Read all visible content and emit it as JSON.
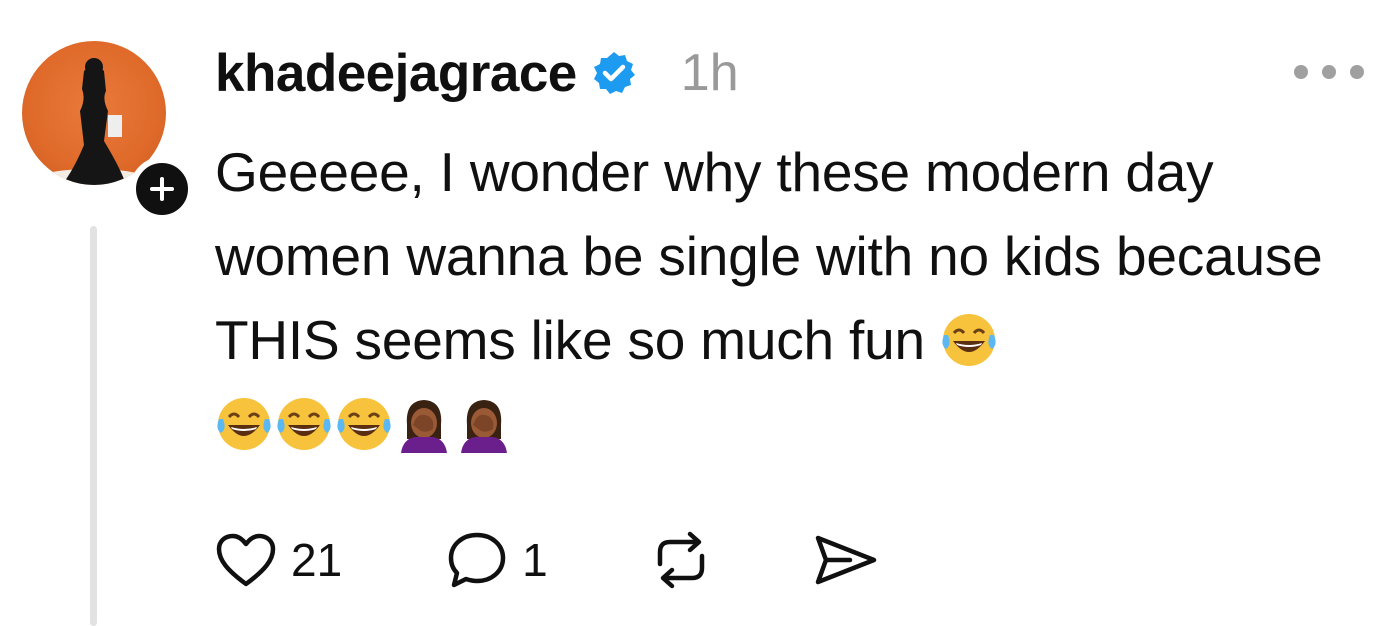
{
  "post": {
    "author": {
      "username": "khadeejagrace",
      "verified": true,
      "avatar_icon": "avatar-photo",
      "follow_icon": "plus-icon"
    },
    "timestamp": "1h",
    "more_icon": "more-options-icon",
    "text": "Geeeee, I wonder why these modern day women wanna be single with no kids because THIS seems like so much fun",
    "emojis": [
      "face-with-tears-of-joy",
      "face-with-tears-of-joy",
      "face-with-tears-of-joy",
      "face-with-tears-of-joy",
      "person-facepalming",
      "person-facepalming"
    ],
    "actions": {
      "like": {
        "icon": "heart-icon",
        "count": "21"
      },
      "reply": {
        "icon": "comment-icon",
        "count": "1"
      },
      "repost": {
        "icon": "repost-icon"
      },
      "share": {
        "icon": "send-icon"
      }
    }
  },
  "colors": {
    "text": "#101010",
    "timestamp": "#999999",
    "verified": "#1d9bf0",
    "thread_line": "#e2e2e2",
    "avatar_bg": "#df6a2a"
  }
}
